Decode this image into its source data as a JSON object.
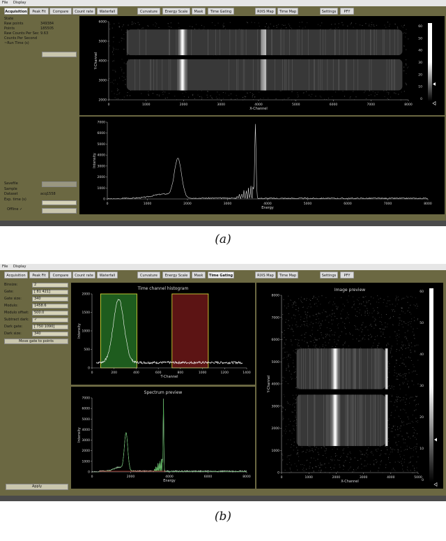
{
  "menu": [
    "File",
    "Display"
  ],
  "panelA": {
    "tabs": [
      {
        "label": "Acquisition",
        "active": true
      },
      {
        "label": "Peak Fit"
      },
      {
        "label": "Compare"
      },
      {
        "label": "Count rate"
      },
      {
        "label": "Waterfall"
      },
      {
        "label": "Curvature"
      },
      {
        "label": "Energy Scale"
      },
      {
        "label": "Mask"
      },
      {
        "label": "Time Gating"
      },
      {
        "label": "RIXS Map"
      },
      {
        "label": "Time Map"
      },
      {
        "label": "Settings"
      },
      {
        "label": "PFY"
      }
    ],
    "info": [
      {
        "label": "State",
        "value": ""
      },
      {
        "label": "Raw points",
        "value": "349384"
      },
      {
        "label": "Points",
        "value": "185505"
      },
      {
        "label": "Raw Counts Per Sec",
        "value": "9.63"
      },
      {
        "label": "Counts Per Second",
        "value": ""
      },
      {
        "label": "~Run Time (s)",
        "value": ""
      }
    ],
    "lower": [
      {
        "label": "Savefile",
        "value": ""
      },
      {
        "label": "Sample",
        "value": ""
      },
      {
        "label": "Dataset",
        "value": "acq1558"
      },
      {
        "label": "Exp. time (s)",
        "value": ""
      }
    ],
    "offline_label": "Offline",
    "offline_check": "✓",
    "image": {
      "xlabel": "X-Channel",
      "ylabel": "Y-Channel",
      "xticks": [
        "0",
        "1000",
        "2000",
        "3000",
        "4000",
        "5000",
        "6000",
        "7000",
        "8000"
      ],
      "yticks": [
        "6000",
        "5000",
        "4000",
        "3000",
        "2000"
      ],
      "colorbar_ticks": [
        "60",
        "50",
        "40",
        "30",
        "20",
        "10",
        "0"
      ]
    },
    "spectrum": {
      "xlabel": "Energy",
      "ylabel": "Intensity",
      "xticks": [
        "0",
        "1000",
        "2000",
        "3000",
        "4000",
        "5000",
        "6000",
        "7000",
        "8000"
      ],
      "yticks": [
        "7000",
        "6000",
        "5000",
        "4000",
        "3000",
        "2000",
        "1000",
        "0"
      ]
    }
  },
  "panelB": {
    "tabs": [
      {
        "label": "Acquisition"
      },
      {
        "label": "Peak Fit"
      },
      {
        "label": "Compare"
      },
      {
        "label": "Count rate"
      },
      {
        "label": "Waterfall"
      },
      {
        "label": "Curvature"
      },
      {
        "label": "Energy Scale"
      },
      {
        "label": "Mask"
      },
      {
        "label": "Time Gating",
        "active": true
      },
      {
        "label": "RIXS Map"
      },
      {
        "label": "Time Map"
      },
      {
        "label": "Settings"
      },
      {
        "label": "PFY"
      }
    ],
    "params": [
      {
        "label": "Binsize:",
        "value": "2"
      },
      {
        "label": "Gate:",
        "value": "[ 81 421]"
      },
      {
        "label": "Gate size:",
        "value": "340"
      },
      {
        "label": "Modulo:",
        "value": "1458.6"
      },
      {
        "label": "Modulo offset:",
        "value": "500.0"
      },
      {
        "label": "Subtract dark:",
        "value": "✓"
      },
      {
        "label": "Dark gate:",
        "value": "[ 750 1090]"
      },
      {
        "label": "Dark size:",
        "value": "340"
      }
    ],
    "move_gate_button": "Move gate to points",
    "apply_button": "Apply",
    "histogram": {
      "title": "Time channel histogram",
      "xlabel": "T-Channel",
      "ylabel": "Intensity",
      "xticks": [
        "0",
        "200",
        "400",
        "600",
        "800",
        "1000",
        "1200",
        "1400"
      ],
      "yticks": [
        "2000",
        "1500",
        "1000",
        "500",
        "0"
      ],
      "gate_color": "#1e5c1e",
      "dark_color": "#5c1414"
    },
    "spectrum_preview": {
      "title": "Spectrum preview",
      "xlabel": "Energy",
      "ylabel": "Intensity",
      "xticks": [
        "0",
        "2000",
        "4000",
        "6000",
        "8000"
      ],
      "yticks": [
        "7000",
        "6000",
        "5000",
        "4000",
        "3000",
        "2000",
        "1000",
        "0"
      ],
      "line_color": "#4caf50"
    },
    "image_preview": {
      "title": "Image preview",
      "xlabel": "X-Channel",
      "ylabel": "Y-Channel",
      "xticks": [
        "0",
        "1000",
        "2000",
        "3000",
        "4000",
        "5000"
      ],
      "yticks": [
        "8000",
        "7000",
        "6000",
        "5000",
        "4000",
        "3000",
        "2000",
        "1000",
        "0"
      ],
      "colorbar_ticks": [
        "60",
        "50",
        "40",
        "30",
        "20",
        "10",
        "0"
      ]
    }
  },
  "captions": {
    "a": "(a)",
    "b": "(b)"
  }
}
